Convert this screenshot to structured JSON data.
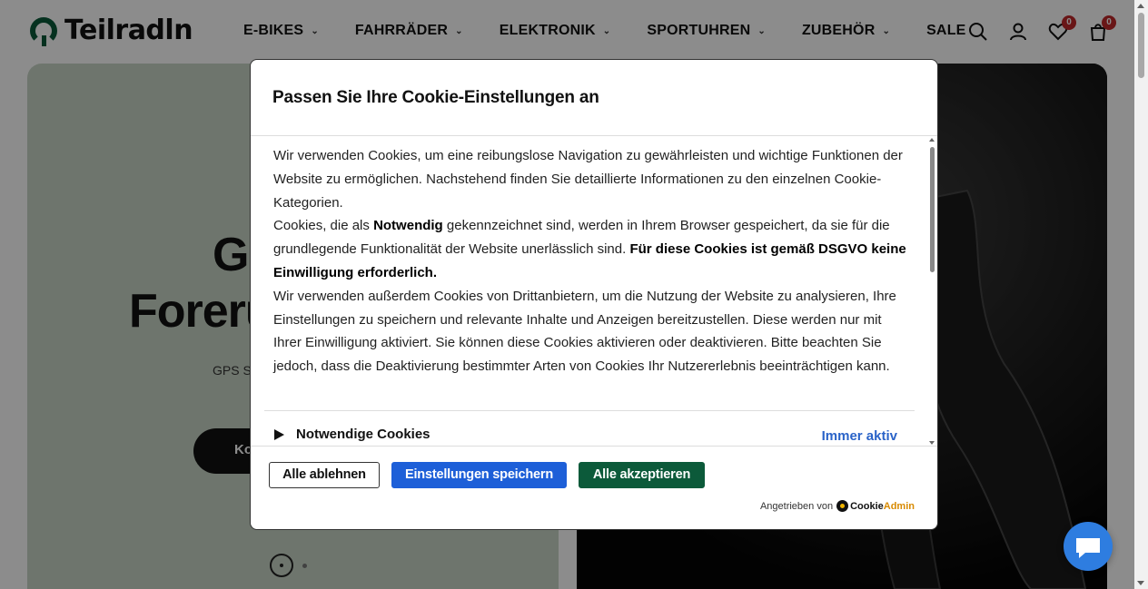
{
  "brand": {
    "name": "Teilradln",
    "color": "#0a5a3a"
  },
  "nav": {
    "items": [
      {
        "label": "E-BIKES",
        "has_dropdown": true
      },
      {
        "label": "FAHRRÄDER",
        "has_dropdown": true
      },
      {
        "label": "ELEKTRONIK",
        "has_dropdown": true
      },
      {
        "label": "SPORTUHREN",
        "has_dropdown": true
      },
      {
        "label": "ZUBEHÖR",
        "has_dropdown": true
      },
      {
        "label": "SALE",
        "has_dropdown": false
      }
    ],
    "icons": [
      "search-icon",
      "account-icon",
      "wishlist-icon",
      "cart-icon"
    ],
    "wishlist_count": "0",
    "cart_count": "0"
  },
  "hero": {
    "title_line1": "G",
    "title_line2": "Foreru",
    "subtitle": "GPS S",
    "button_label": "Ko",
    "slide_count": 2,
    "active_slide": 1
  },
  "cookie_modal": {
    "title": "Passen Sie Ihre Cookie-Einstellungen an",
    "para1": "Wir verwenden Cookies, um eine reibungslose Navigation zu gewährleisten und wichtige Funktionen der Website zu ermöglichen. Nachstehend finden Sie detaillierte Informationen zu den einzelnen Cookie-Kategorien.",
    "para2_a": "Cookies, die als ",
    "para2_b": "Notwendig",
    "para2_c": " gekennzeichnet sind, werden in Ihrem Browser gespeichert, da sie für die grundlegende Funktionalität der Website unerlässlich sind. ",
    "para2_d": "Für diese Cookies ist gemäß DSGVO keine Einwilligung erforderlich.",
    "para3": "Wir verwenden außerdem Cookies von Drittanbietern, um die Nutzung der Website zu analysieren, Ihre Einstellungen zu speichern und relevante Inhalte und Anzeigen bereitzustellen. Diese werden nur mit Ihrer Einwilligung aktiviert. Sie können diese Cookies aktivieren oder deaktivieren. Bitte beachten Sie jedoch, dass die Deaktivierung bestimmter Arten von Cookies Ihr Nutzererlebnis beeinträchtigen kann.",
    "category": {
      "label": "Notwendige Cookies",
      "status": "Immer aktiv"
    },
    "buttons": {
      "reject": "Alle ablehnen",
      "save": "Einstellungen speichern",
      "accept": "Alle akzeptieren"
    },
    "powered_by": "Angetrieben von",
    "provider_a": "Cookie",
    "provider_b": "Admin",
    "colors": {
      "save": "#1d5fd8",
      "accept": "#0c5a3a",
      "status": "#2a63c8"
    }
  }
}
